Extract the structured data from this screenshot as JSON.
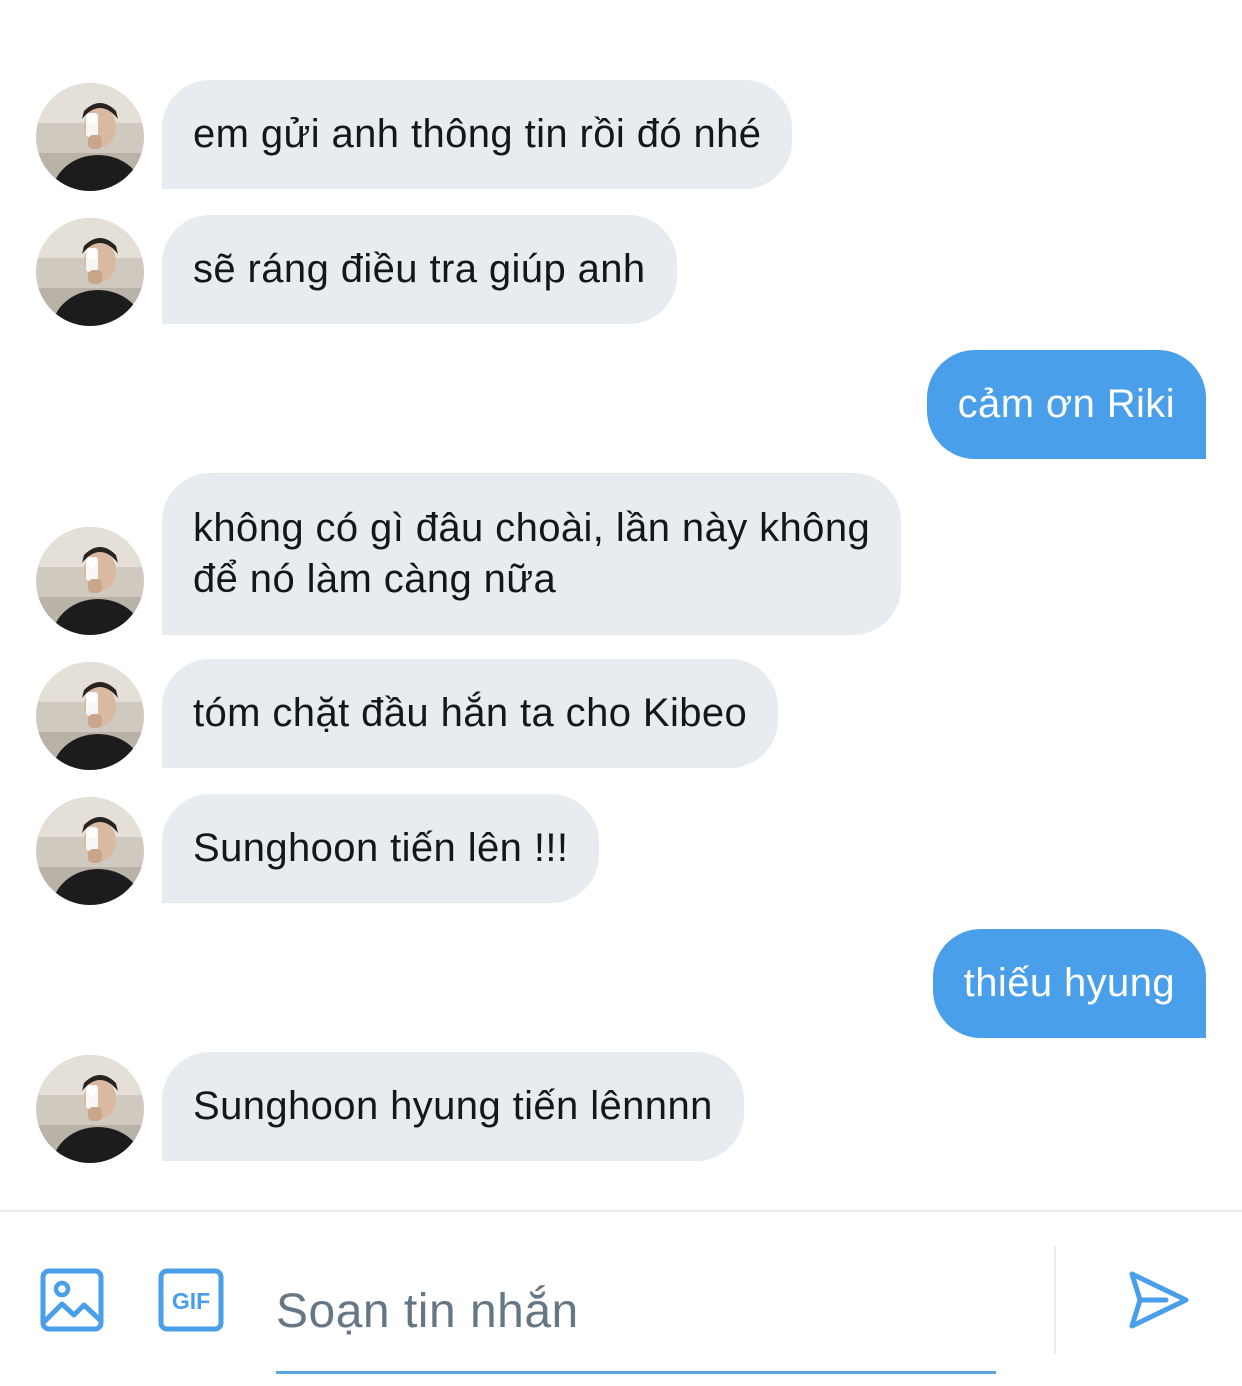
{
  "messages": [
    {
      "direction": "incoming",
      "text": "em gửi anh thông tin rồi đó nhé"
    },
    {
      "direction": "incoming",
      "text": "sẽ ráng điều tra giúp anh"
    },
    {
      "direction": "outgoing",
      "text": "cảm ơn Riki"
    },
    {
      "direction": "incoming",
      "text_line1": "không có gì đâu choài, lần này không",
      "text_line2": "để nó làm càng nữa"
    },
    {
      "direction": "incoming",
      "text": "tóm chặt đầu hắn ta cho Kibeo"
    },
    {
      "direction": "incoming",
      "text": "Sunghoon tiến lên !!!"
    },
    {
      "direction": "outgoing",
      "text": "thiếu hyung"
    },
    {
      "direction": "incoming",
      "text": "Sunghoon hyung tiến lênnnn"
    }
  ],
  "composer": {
    "placeholder": "Soạn tin nhắn",
    "gif_label": "GIF",
    "icons": [
      "image-icon",
      "gif-icon",
      "send-icon"
    ]
  },
  "colors": {
    "incoming_bubble": "#e6ecf0",
    "outgoing_bubble": "#4a9fea",
    "accent": "#4a9fea"
  }
}
